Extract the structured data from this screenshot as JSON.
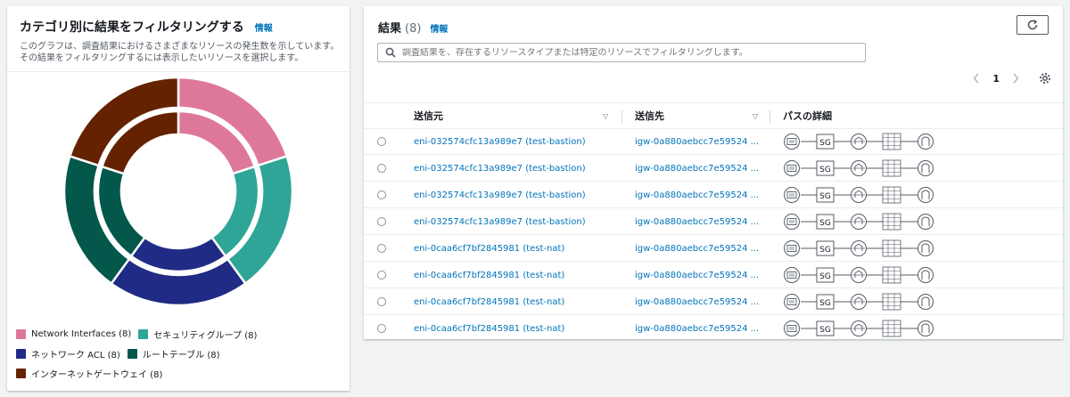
{
  "left_panel": {
    "title": "カテゴリ別に結果をフィルタリングする",
    "info": "情報",
    "description": "このグラフは、調査結果におけるさまざまなリソースの発生数を示しています。その結果をフィルタリングするには表示したいリソースを選択します。",
    "legend": [
      {
        "label": "Network Interfaces (8)",
        "color": "#de7899"
      },
      {
        "label": "セキュリティグループ (8)",
        "color": "#2ea597"
      },
      {
        "label": "ネットワーク ACL (8)",
        "color": "#1f2b84"
      },
      {
        "label": "ルートテーブル (8)",
        "color": "#03584b"
      },
      {
        "label": "インターネットゲートウェイ (8)",
        "color": "#652200"
      }
    ]
  },
  "chart_data": {
    "type": "pie",
    "rings": [
      {
        "name": "outer",
        "values": [
          8,
          8,
          8,
          8,
          8
        ]
      },
      {
        "name": "inner",
        "values": [
          8,
          8,
          8,
          8,
          8
        ]
      }
    ],
    "categories": [
      "Network Interfaces",
      "セキュリティグループ",
      "ネットワーク ACL",
      "ルートテーブル",
      "インターネットゲートウェイ"
    ],
    "colors": [
      "#de7899",
      "#2ea597",
      "#1f2b84",
      "#03584b",
      "#652200"
    ]
  },
  "right_panel": {
    "title": "結果",
    "count": "(8)",
    "info": "情報",
    "search_placeholder": "調査結果を、存在するリソースタイプまたは特定のリソースでフィルタリングします。",
    "page": "1",
    "columns": [
      "送信元",
      "送信先",
      "パスの詳細"
    ],
    "rows": [
      {
        "source": "eni-032574cfc13a989e7 (test-bastion)",
        "destination": "igw-0a880aebcc7e59524 ..."
      },
      {
        "source": "eni-032574cfc13a989e7 (test-bastion)",
        "destination": "igw-0a880aebcc7e59524 ..."
      },
      {
        "source": "eni-032574cfc13a989e7 (test-bastion)",
        "destination": "igw-0a880aebcc7e59524 ..."
      },
      {
        "source": "eni-032574cfc13a989e7 (test-bastion)",
        "destination": "igw-0a880aebcc7e59524 ..."
      },
      {
        "source": "eni-0caa6cf7bf2845981 (test-nat)",
        "destination": "igw-0a880aebcc7e59524 ..."
      },
      {
        "source": "eni-0caa6cf7bf2845981 (test-nat)",
        "destination": "igw-0a880aebcc7e59524 ..."
      },
      {
        "source": "eni-0caa6cf7bf2845981 (test-nat)",
        "destination": "igw-0a880aebcc7e59524 ..."
      },
      {
        "source": "eni-0caa6cf7bf2845981 (test-nat)",
        "destination": "igw-0a880aebcc7e59524 ..."
      }
    ],
    "path_sg_label": "SG"
  }
}
